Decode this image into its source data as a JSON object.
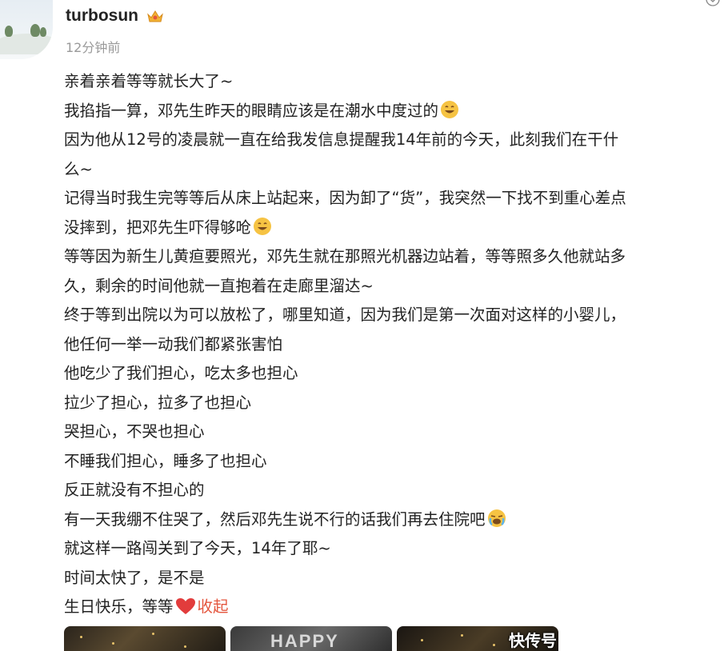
{
  "header": {
    "username": "turbosun",
    "timestamp": "12分钟前",
    "vip_icon": "crown-badge-icon",
    "more_icon": "chevron-down-icon"
  },
  "post": {
    "lines": [
      "亲着亲着等等就长大了~",
      "我掐指一算，邓先生昨天的眼睛应该是在潮水中度过的",
      "因为他从12号的凌晨就一直在给我发信息提醒我14年前的今天，此刻我们在干什",
      "么~",
      "记得当时我生完等等后从床上站起来，因为卸了“货”，我突然一下找不到重心差点",
      "没摔到，把邓先生吓得够呛",
      "等等因为新生儿黄疸要照光，邓先生就在那照光机器边站着，等等照多久他就站多",
      "久，剩余的时间他就一直抱着在走廊里溜达~",
      "终于等到出院以为可以放松了，哪里知道，因为我们是第一次面对这样的小婴儿，",
      "他任何一举一动我们都紧张害怕",
      "他吃少了我们担心，吃太多也担心",
      "拉少了担心，拉多了也担心",
      "哭担心，不哭也担心",
      "不睡我们担心，睡多了也担心",
      "反正就没有不担心的",
      "有一天我绷不住哭了，然后邓先生说不行的话我们再去住院吧",
      "就这样一路闯关到了今天，14年了耶~",
      "时间太快了，是不是",
      "生日快乐，等等"
    ],
    "collapse_label": "收起"
  },
  "images": {
    "thumb2_text": "HAPPY"
  },
  "watermark": "快传号",
  "colors": {
    "accent": "#e4553d",
    "timestamp": "#9a9a9a",
    "text": "#222222",
    "heart": "#e23c3c",
    "emoji": "#f6c343"
  }
}
